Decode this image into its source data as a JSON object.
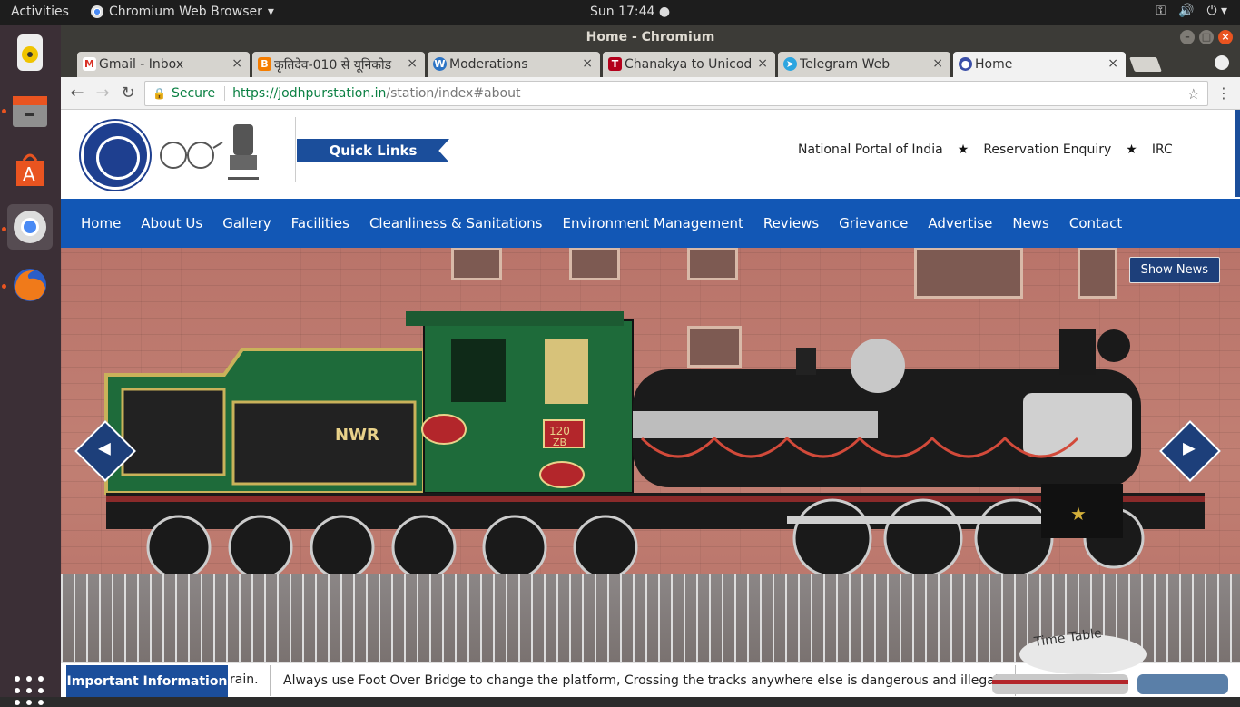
{
  "system": {
    "activities": "Activities",
    "app_menu": "Chromium Web Browser",
    "clock": "Sun 17:44"
  },
  "window": {
    "title": "Home - Chromium"
  },
  "tabs": [
    {
      "label": "Gmail - Inbox",
      "icon": "gmail-icon"
    },
    {
      "label": "कृतिदेव-010 से यूनिकोड",
      "icon": "blogger-icon"
    },
    {
      "label": "Moderations",
      "icon": "wordpress-icon"
    },
    {
      "label": "Chanakya to Unicode",
      "icon": "t-icon"
    },
    {
      "label": "Telegram Web",
      "icon": "telegram-icon"
    },
    {
      "label": "Home",
      "icon": "site-icon"
    }
  ],
  "address": {
    "secure_label": "Secure",
    "url_host": "https://jodhpurstation.in",
    "url_path": "/station/index#about"
  },
  "header": {
    "quick_links": "Quick Links",
    "top_links": [
      "National Portal of India",
      "Reservation Enquiry",
      "IRC"
    ]
  },
  "nav": [
    "Home",
    "About Us",
    "Gallery",
    "Facilities",
    "Cleanliness & Sanitations",
    "Environment Management",
    "Reviews",
    "Grievance",
    "Advertise",
    "News",
    "Contact"
  ],
  "hero": {
    "show_news": "Show News",
    "loco_badge": "NWR",
    "loco_number": "120",
    "loco_class": "ZB"
  },
  "ticker": {
    "label": "Important Information",
    "fragment": "rain.",
    "message": "Always use Foot Over Bridge to change the platform, Crossing the tracks anywhere else is dangerous and illegal.",
    "time_table": "Time Table"
  },
  "colors": {
    "brand_blue": "#1257b5",
    "dark_blue": "#1d3f7a",
    "secure_green": "#0b8043"
  }
}
